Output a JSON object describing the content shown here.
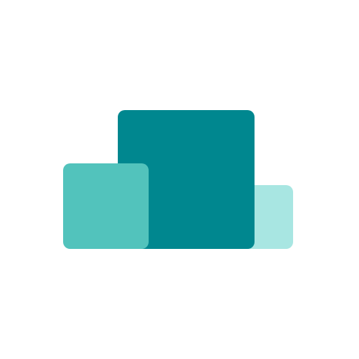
{
  "logo": {
    "icon": "stacked-squares-logo-icon",
    "colors": {
      "background": "#ffffff",
      "back_right_square": "#a8e6e2",
      "center_square": "#00878f",
      "front_left_square": "#52c3bc"
    }
  }
}
